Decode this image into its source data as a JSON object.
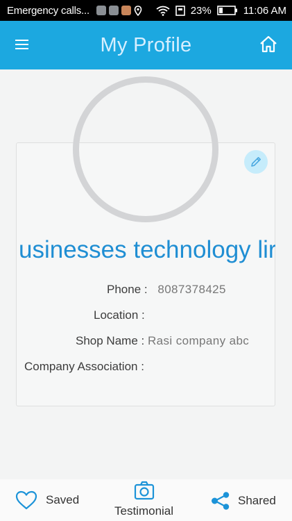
{
  "status_bar": {
    "notification_text": "Emergency calls...",
    "battery": "23%",
    "time": "11:06 AM"
  },
  "header": {
    "title": "My Profile",
    "menu_icon": "hamburger-menu-icon",
    "home_icon": "home-icon"
  },
  "profile": {
    "business_name": "usinesses technology lir",
    "edit_icon": "pencil-icon",
    "fields": {
      "phone_label": "Phone :",
      "phone_value": "8087378425",
      "location_label": "Location :",
      "location_value": "",
      "shop_name_label": "Shop Name :",
      "shop_name_value": "Rasi company abc",
      "company_association_label": "Company Association :",
      "company_association_value": ""
    }
  },
  "bottom_nav": {
    "saved_label": "Saved",
    "testimonial_label": "Testimonial",
    "shared_label": "Shared"
  },
  "colors": {
    "app_bar": "#1ca8e0",
    "accent_text": "#1f8ed3",
    "edit_button_bg": "#c6ecfb"
  }
}
